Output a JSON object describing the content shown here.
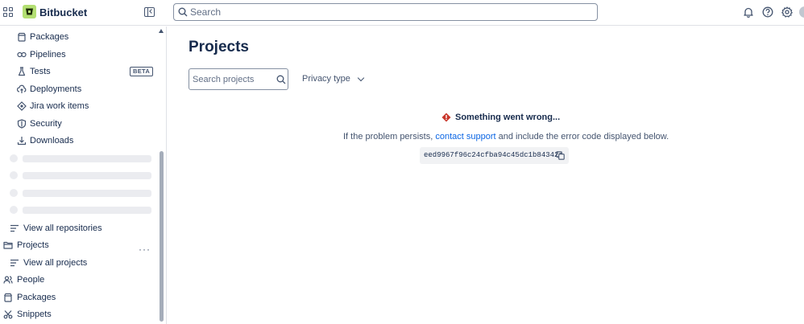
{
  "header": {
    "brand": "Bitbucket",
    "search_placeholder": "Search"
  },
  "sidebar": {
    "items": [
      {
        "label": "Packages",
        "icon": "package-icon"
      },
      {
        "label": "Pipelines",
        "icon": "pipelines-icon"
      },
      {
        "label": "Tests",
        "icon": "flask-icon",
        "badge": "BETA"
      },
      {
        "label": "Deployments",
        "icon": "cloud-upload-icon"
      },
      {
        "label": "Jira work items",
        "icon": "jira-icon"
      },
      {
        "label": "Security",
        "icon": "shield-icon"
      },
      {
        "label": "Downloads",
        "icon": "download-icon"
      }
    ],
    "view_all_repositories": "View all repositories",
    "projects_label": "Projects",
    "view_all_projects": "View all projects",
    "people_label": "People",
    "packages_label": "Packages",
    "snippets_label": "Snippets"
  },
  "main": {
    "title": "Projects",
    "search_projects_placeholder": "Search projects",
    "privacy_filter": "Privacy type",
    "error": {
      "title": "Something went wrong...",
      "message_before": "If the problem persists, ",
      "link_text": "contact support",
      "message_after": " and include the error code displayed below.",
      "code": "eed9967f96c24cfba94c45dc1b84342a"
    }
  },
  "colors": {
    "brand_logo": "#b3df72",
    "link": "#0c66e4",
    "error_icon": "#c9372c"
  }
}
